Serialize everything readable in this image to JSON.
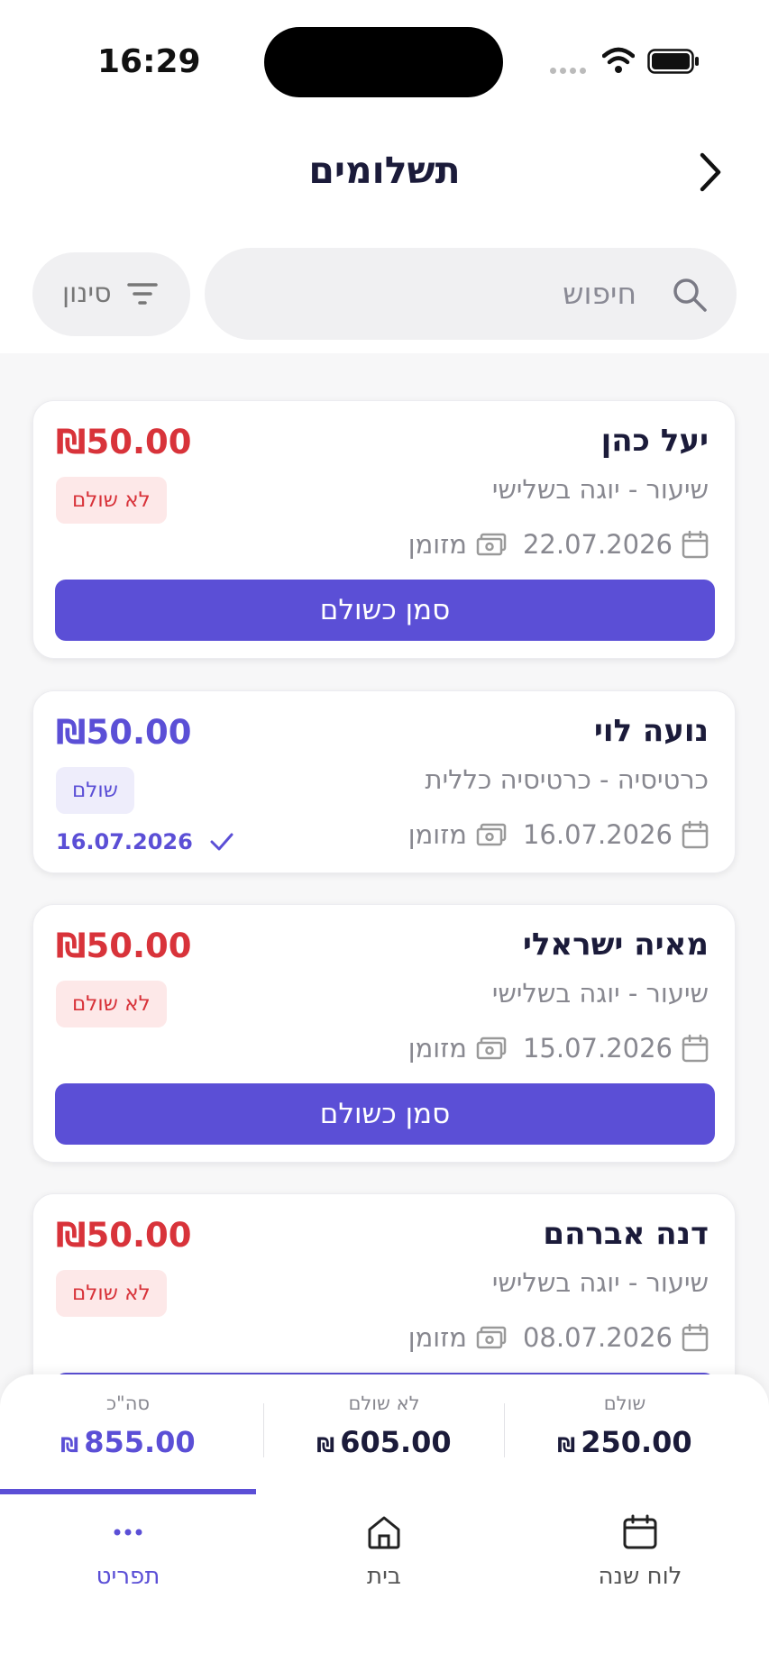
{
  "status_bar": {
    "time": "16:29"
  },
  "header": {
    "title": "תשלומים"
  },
  "search": {
    "placeholder": "חיפוש"
  },
  "filter": {
    "label": "סינון"
  },
  "payments": [
    {
      "name": "יעל כהן",
      "subtitle": "שיעור - יוגה בשלישי",
      "date": "22.07.2026",
      "method": "מזומן",
      "amount": "₪50.00",
      "status": "לא שולם",
      "action": "סמן כשולם"
    },
    {
      "name": "נועה לוי",
      "subtitle": "כרטיסיה - כרטיסיה כללית",
      "date": "16.07.2026",
      "method": "מזומן",
      "amount": "₪50.00",
      "status": "שולם",
      "paid_date": "16.07.2026"
    },
    {
      "name": "מאיה ישראלי",
      "subtitle": "שיעור - יוגה בשלישי",
      "date": "15.07.2026",
      "method": "מזומן",
      "amount": "₪50.00",
      "status": "לא שולם",
      "action": "סמן כשולם"
    },
    {
      "name": "דנה אברהם",
      "subtitle": "שיעור - יוגה בשלישי",
      "date": "08.07.2026",
      "method": "מזומן",
      "amount": "₪50.00",
      "status": "לא שולם"
    }
  ],
  "summary": {
    "currency": "₪",
    "paid": {
      "label": "שולם",
      "value": "250.00"
    },
    "unpaid": {
      "label": "לא שולם",
      "value": "605.00"
    },
    "total": {
      "label": "סה\"כ",
      "value": "855.00"
    }
  },
  "nav": {
    "items": [
      {
        "label": "לוח שנה",
        "icon": "calendar-icon"
      },
      {
        "label": "בית",
        "icon": "home-icon"
      },
      {
        "label": "תפריט",
        "icon": "more-icon",
        "active": true
      }
    ]
  },
  "colors": {
    "accent": "#5b4fd6",
    "danger": "#d8333a"
  }
}
